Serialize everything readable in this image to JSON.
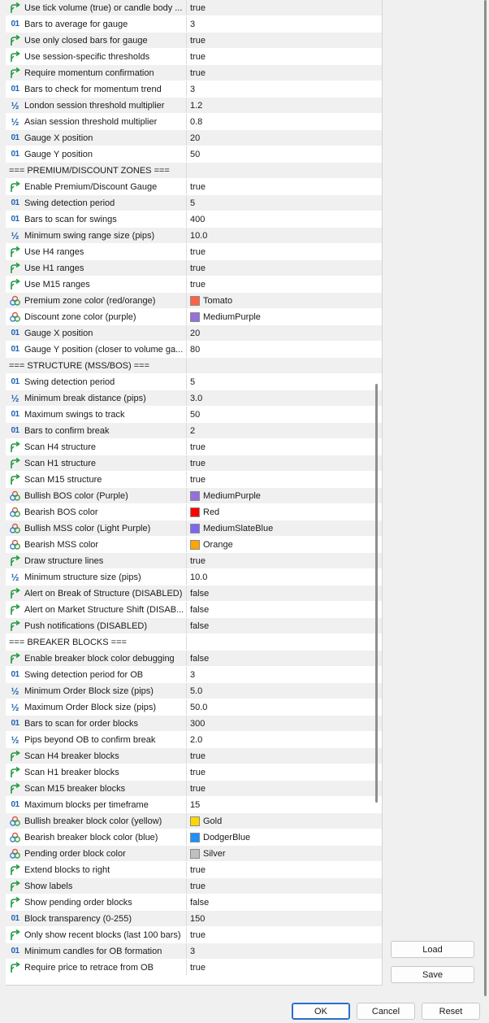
{
  "params": [
    {
      "type": "bool",
      "label": "Use tick volume (true) or candle body ...",
      "value": "true"
    },
    {
      "type": "int",
      "label": "Bars to average for gauge",
      "value": "3"
    },
    {
      "type": "bool",
      "label": "Use only closed bars for gauge",
      "value": "true"
    },
    {
      "type": "bool",
      "label": "Use session-specific thresholds",
      "value": "true"
    },
    {
      "type": "bool",
      "label": "Require momentum confirmation",
      "value": "true"
    },
    {
      "type": "int",
      "label": "Bars to check for momentum trend",
      "value": "3"
    },
    {
      "type": "double",
      "label": "London session threshold multiplier",
      "value": "1.2"
    },
    {
      "type": "double",
      "label": "Asian session threshold multiplier",
      "value": "0.8"
    },
    {
      "type": "int",
      "label": "Gauge X position",
      "value": "20"
    },
    {
      "type": "int",
      "label": "Gauge Y position",
      "value": "50"
    },
    {
      "type": "section",
      "label": "=== PREMIUM/DISCOUNT ZONES ===",
      "value": ""
    },
    {
      "type": "bool",
      "label": "Enable Premium/Discount Gauge",
      "value": "true"
    },
    {
      "type": "int",
      "label": "Swing detection period",
      "value": "5"
    },
    {
      "type": "int",
      "label": "Bars to scan for swings",
      "value": "400"
    },
    {
      "type": "double",
      "label": "Minimum swing range size (pips)",
      "value": "10.0"
    },
    {
      "type": "bool",
      "label": "Use H4 ranges",
      "value": "true"
    },
    {
      "type": "bool",
      "label": "Use H1 ranges",
      "value": "true"
    },
    {
      "type": "bool",
      "label": "Use M15 ranges",
      "value": "true"
    },
    {
      "type": "color",
      "label": "Premium zone color (red/orange)",
      "value": "Tomato",
      "color": "#ff6347"
    },
    {
      "type": "color",
      "label": "Discount zone color (purple)",
      "value": "MediumPurple",
      "color": "#9370db"
    },
    {
      "type": "int",
      "label": "Gauge X position",
      "value": "20"
    },
    {
      "type": "int",
      "label": "Gauge Y position (closer to volume ga...",
      "value": "80"
    },
    {
      "type": "section",
      "label": "=== STRUCTURE (MSS/BOS) ===",
      "value": ""
    },
    {
      "type": "int",
      "label": "Swing detection period",
      "value": "5"
    },
    {
      "type": "double",
      "label": "Minimum break distance (pips)",
      "value": "3.0"
    },
    {
      "type": "int",
      "label": "Maximum swings to track",
      "value": "50"
    },
    {
      "type": "int",
      "label": "Bars to confirm break",
      "value": "2"
    },
    {
      "type": "bool",
      "label": "Scan H4 structure",
      "value": "true"
    },
    {
      "type": "bool",
      "label": "Scan H1 structure",
      "value": "true"
    },
    {
      "type": "bool",
      "label": "Scan M15 structure",
      "value": "true"
    },
    {
      "type": "color",
      "label": "Bullish BOS color (Purple)",
      "value": "MediumPurple",
      "color": "#9370db"
    },
    {
      "type": "color",
      "label": "Bearish BOS color",
      "value": "Red",
      "color": "#ff0000"
    },
    {
      "type": "color",
      "label": "Bullish MSS color (Light Purple)",
      "value": "MediumSlateBlue",
      "color": "#7b68ee"
    },
    {
      "type": "color",
      "label": "Bearish MSS color",
      "value": "Orange",
      "color": "#ffa500"
    },
    {
      "type": "bool",
      "label": "Draw structure lines",
      "value": "true"
    },
    {
      "type": "double",
      "label": "Minimum structure size (pips)",
      "value": "10.0"
    },
    {
      "type": "bool",
      "label": "Alert on Break of Structure (DISABLED)",
      "value": "false"
    },
    {
      "type": "bool",
      "label": "Alert on Market Structure Shift (DISAB...",
      "value": "false"
    },
    {
      "type": "bool",
      "label": "Push notifications (DISABLED)",
      "value": "false"
    },
    {
      "type": "section",
      "label": "=== BREAKER BLOCKS ===",
      "value": ""
    },
    {
      "type": "bool",
      "label": "Enable breaker block color debugging",
      "value": "false"
    },
    {
      "type": "int",
      "label": "Swing detection period for OB",
      "value": "3"
    },
    {
      "type": "double",
      "label": "Minimum Order Block size (pips)",
      "value": "5.0"
    },
    {
      "type": "double",
      "label": "Maximum Order Block size (pips)",
      "value": "50.0"
    },
    {
      "type": "int",
      "label": "Bars to scan for order blocks",
      "value": "300"
    },
    {
      "type": "double",
      "label": "Pips beyond OB to confirm break",
      "value": "2.0"
    },
    {
      "type": "bool",
      "label": "Scan H4 breaker blocks",
      "value": "true"
    },
    {
      "type": "bool",
      "label": "Scan H1 breaker blocks",
      "value": "true"
    },
    {
      "type": "bool",
      "label": "Scan M15 breaker blocks",
      "value": "true"
    },
    {
      "type": "int",
      "label": "Maximum blocks per timeframe",
      "value": "15"
    },
    {
      "type": "color",
      "label": "Bullish breaker block color (yellow)",
      "value": "Gold",
      "color": "#ffd700"
    },
    {
      "type": "color",
      "label": "Bearish breaker block color (blue)",
      "value": "DodgerBlue",
      "color": "#1e90ff"
    },
    {
      "type": "color",
      "label": "Pending order block color",
      "value": "Silver",
      "color": "#c0c0c0"
    },
    {
      "type": "bool",
      "label": "Extend blocks to right",
      "value": "true"
    },
    {
      "type": "bool",
      "label": "Show labels",
      "value": "true"
    },
    {
      "type": "bool",
      "label": "Show pending order blocks",
      "value": "false"
    },
    {
      "type": "int",
      "label": "Block transparency (0-255)",
      "value": "150"
    },
    {
      "type": "bool",
      "label": "Only show recent blocks (last 100 bars)",
      "value": "true"
    },
    {
      "type": "int",
      "label": "Minimum candles for OB formation",
      "value": "3"
    },
    {
      "type": "bool",
      "label": "Require price to retrace from OB",
      "value": "true"
    }
  ],
  "icons": {
    "int": "01",
    "double": "½"
  },
  "buttons": {
    "load": "Load",
    "save": "Save",
    "ok": "OK",
    "cancel": "Cancel",
    "reset": "Reset"
  }
}
